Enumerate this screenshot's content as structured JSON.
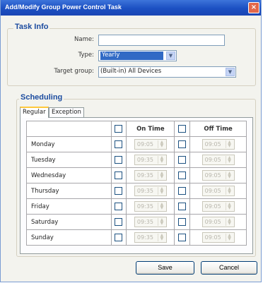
{
  "window": {
    "title": "Add/Modify Group Power Control Task"
  },
  "task_info": {
    "legend": "Task Info",
    "name_label": "Name:",
    "name_value": "",
    "type_label": "Type:",
    "type_value": "Yearly",
    "target_label": "Target group:",
    "target_value": "(Built-in) All Devices"
  },
  "scheduling": {
    "legend": "Scheduling",
    "tabs": [
      "Regular",
      "Exception"
    ],
    "on_time_header": "On Time",
    "off_time_header": "Off Time",
    "rows": [
      {
        "day": "Monday",
        "on": "09:05",
        "off": "09:05"
      },
      {
        "day": "Tuesday",
        "on": "09:35",
        "off": "09:05"
      },
      {
        "day": "Wednesday",
        "on": "09:35",
        "off": "09:05"
      },
      {
        "day": "Thursday",
        "on": "09:35",
        "off": "09:05"
      },
      {
        "day": "Friday",
        "on": "09:35",
        "off": "09:05"
      },
      {
        "day": "Saturday",
        "on": "09:35",
        "off": "09:05"
      },
      {
        "day": "Sunday",
        "on": "09:35",
        "off": "09:05"
      }
    ]
  },
  "buttons": {
    "save": "Save",
    "cancel": "Cancel"
  },
  "colors": {
    "titlebar": "#1b4fc2",
    "legend": "#1b4b9f",
    "selection": "#316ac5"
  }
}
